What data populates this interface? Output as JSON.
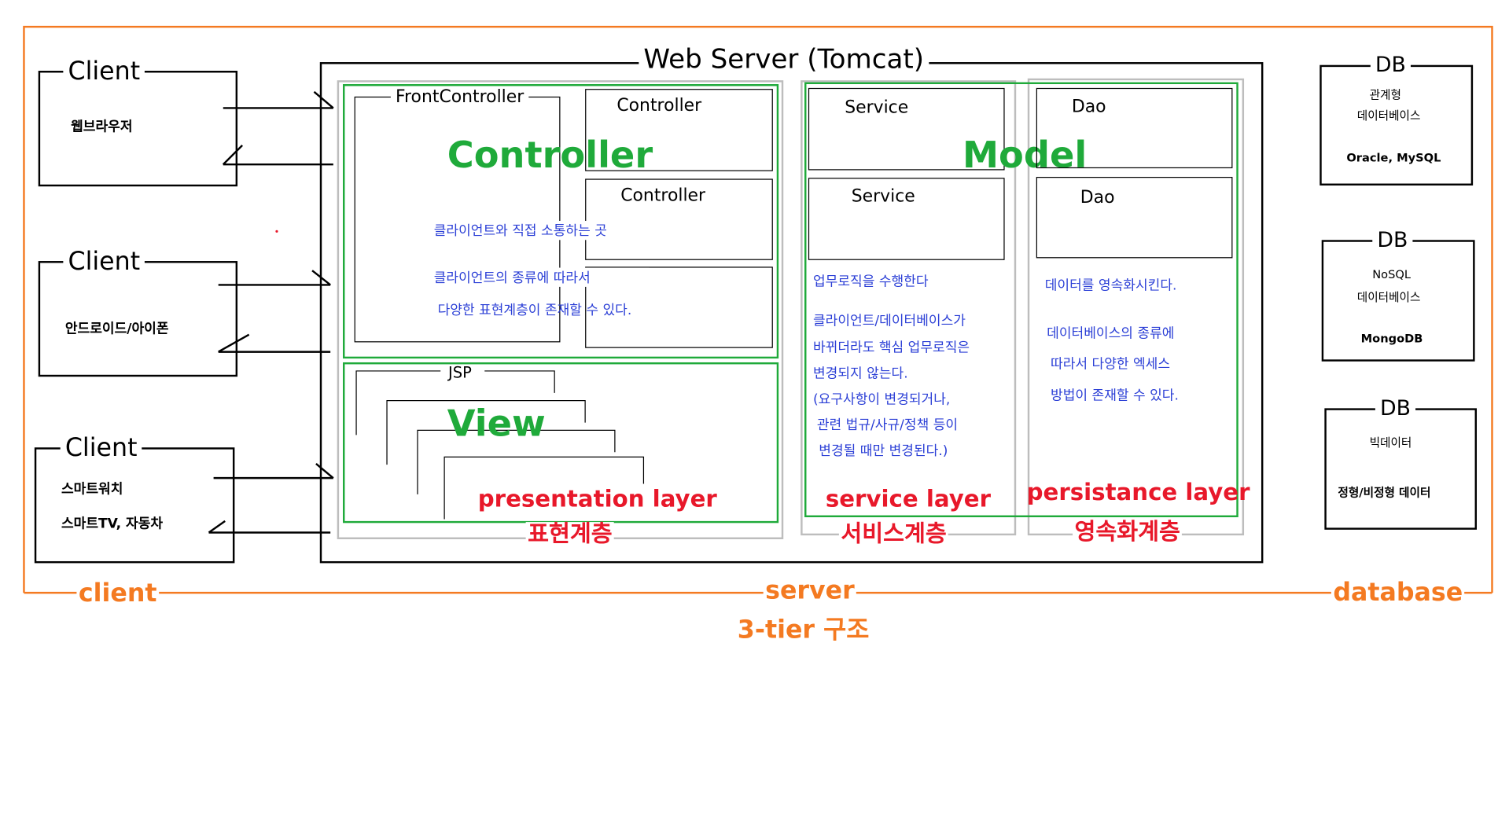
{
  "web_server": {
    "title": "Web Server (Tomcat)"
  },
  "clients": [
    {
      "title": "Client",
      "desc": "웹브라우저"
    },
    {
      "title": "Client",
      "desc": "안드로이드/아이폰"
    },
    {
      "title": "Client",
      "desc_line1": "스마트워치",
      "desc_line2": "스마트TV, 자동차"
    }
  ],
  "controller_area": {
    "front_controller": "FrontController",
    "controller_1": "Controller",
    "controller_2": "Controller",
    "big_label": "Controller",
    "desc_line1": "클라이언트와 직접 소통하는 곳",
    "desc_line2": "클라이언트의 종류에 따라서",
    "desc_line3": "다양한 표현계층이 존재할 수 있다."
  },
  "view_area": {
    "jsp": "JSP",
    "big_label": "View"
  },
  "presentation": {
    "layer_en": "presentation layer",
    "layer_ko": "표현계층"
  },
  "service_area": {
    "service_1": "Service",
    "service_2": "Service",
    "desc": [
      "업무로직을 수행한다",
      "클라이언트/데이터베이스가",
      "바뀌더라도 핵심 업무로직은",
      "변경되지 않는다.",
      "(요구사항이 변경되거나,",
      "관련 법규/사규/정책 등이",
      "변경될 때만 변경된다.)"
    ],
    "layer_en": "service layer",
    "layer_ko": "서비스계층"
  },
  "model": {
    "big_label": "Model"
  },
  "persistence_area": {
    "dao_1": "Dao",
    "dao_2": "Dao",
    "desc": [
      "데이터를 영속화시킨다.",
      "데이터베이스의 종류에",
      "따라서 다양한 엑세스",
      "방법이 존재할 수 있다."
    ],
    "layer_en": "persistance layer",
    "layer_ko": "영속화계층"
  },
  "databases": [
    {
      "title": "DB",
      "line1": "관계형",
      "line2": "데이터베이스",
      "example": "Oracle, MySQL"
    },
    {
      "title": "DB",
      "line1": "NoSQL",
      "line2": "데이터베이스",
      "example": "MongoDB"
    },
    {
      "title": "DB",
      "line1": "빅데이터",
      "example": "정형/비정형 데이터"
    }
  ],
  "tiers": {
    "client": "client",
    "server": "server",
    "database": "database",
    "caption": "3-tier 구조"
  },
  "colors": {
    "orange": "#f47a21",
    "green": "#1faa3a",
    "red": "#e8182a",
    "blue": "#2b3fd6",
    "gray": "#bdbdbd"
  }
}
